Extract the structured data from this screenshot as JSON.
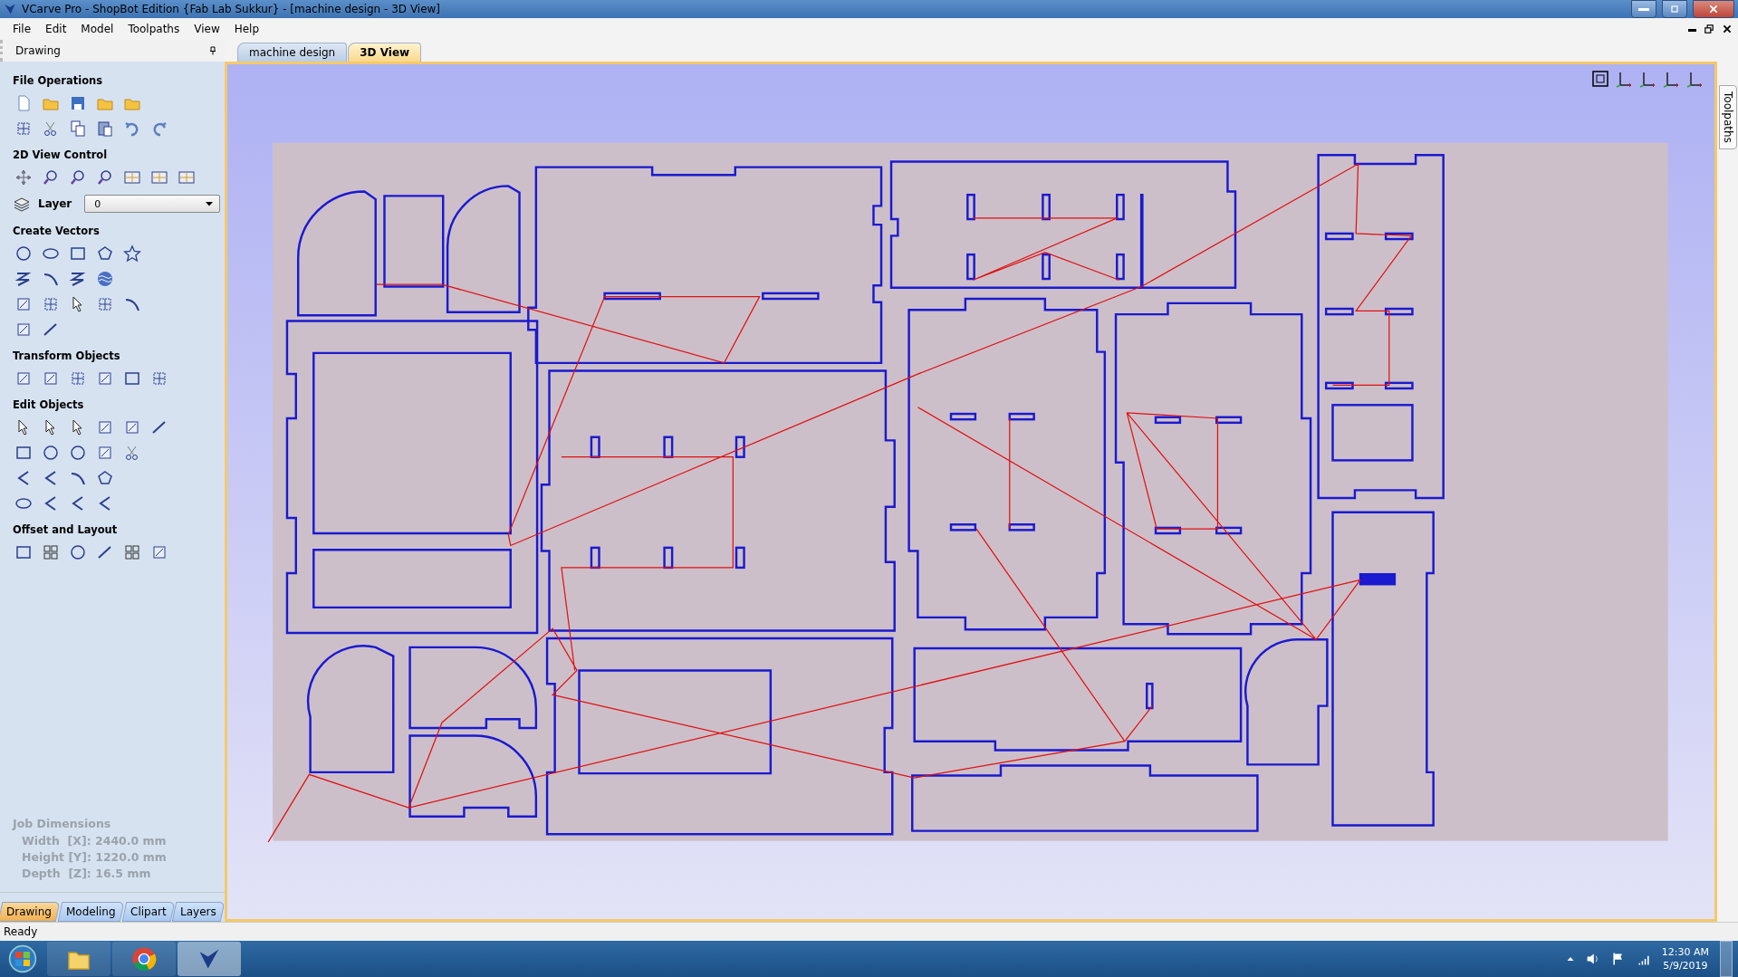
{
  "window": {
    "title": "VCarve Pro - ShopBot Edition {Fab Lab Sukkur} - [machine design - 3D View]"
  },
  "menu": [
    "File",
    "Edit",
    "Model",
    "Toolpaths",
    "View",
    "Help"
  ],
  "panel": {
    "title": "Drawing",
    "sections": [
      {
        "title": "File Operations"
      },
      {
        "title": "2D View Control"
      },
      {
        "title": "Create Vectors"
      },
      {
        "title": "Transform Objects"
      },
      {
        "title": "Edit Objects"
      },
      {
        "title": "Offset and Layout"
      }
    ],
    "layer": {
      "label": "Layer",
      "value": "0"
    },
    "job_dimensions": {
      "title": "Job Dimensions",
      "lines": [
        "Width  [X]: 2440.0 mm",
        "Height [Y]: 1220.0 mm",
        "Depth  [Z]: 16.5 mm"
      ]
    },
    "tabs": [
      {
        "label": "Drawing",
        "selected": true
      },
      {
        "label": "Modeling",
        "selected": false
      },
      {
        "label": "Clipart",
        "selected": false
      },
      {
        "label": "Layers",
        "selected": false
      }
    ]
  },
  "document_tabs": [
    {
      "label": "machine design",
      "selected": false
    },
    {
      "label": "3D View",
      "selected": true
    }
  ],
  "side_tab": "Toolpaths",
  "status_bar": "Ready",
  "taskbar": {
    "time": "12:30 AM",
    "date": "5/9/2019"
  }
}
